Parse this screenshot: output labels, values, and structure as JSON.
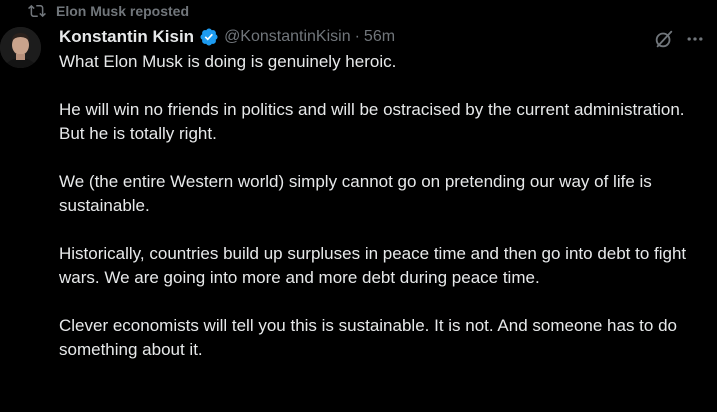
{
  "repost": {
    "label": "Elon Musk reposted"
  },
  "author": {
    "display_name": "Konstantin Kisin",
    "handle": "@KonstantinKisin",
    "separator": "·",
    "time": "56m",
    "verified": true
  },
  "body": {
    "paragraphs": [
      "What Elon Musk is doing is genuinely heroic.",
      "He will win no friends in politics and will be ostracised by the current administration. But he is totally right.",
      "We (the entire Western world) simply cannot go on pretending our way of life is sustainable.",
      "Historically, countries build up surpluses in peace time and then go into debt to fight wars. We are going into more and more debt during peace time.",
      "Clever economists will tell you this is sustainable. It is not. And someone has to do something about it."
    ]
  },
  "icons": {
    "repost": "repost-icon",
    "verified": "verified-badge-icon",
    "grok": "grok-icon",
    "more": "more-icon"
  },
  "colors": {
    "background": "#000000",
    "text": "#e7e9ea",
    "secondary": "#71767b",
    "verified": "#1d9bf0"
  }
}
